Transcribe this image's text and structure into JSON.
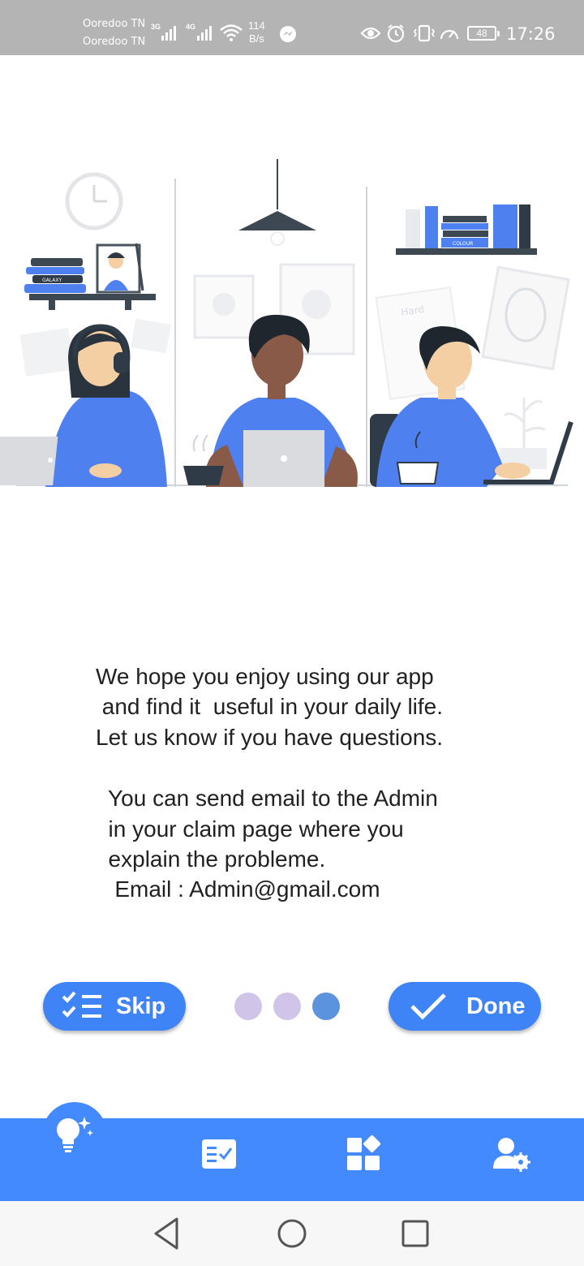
{
  "status_bar": {
    "carrier_1": "Ooredoo TN",
    "carrier_2": "Ooredoo TN",
    "net_1": "3G",
    "net_2": "4G",
    "speed_value": "114",
    "speed_unit": "B/s",
    "battery": "48",
    "time": "17:26",
    "icons": [
      "signal-icon",
      "wifi-icon",
      "messenger-icon",
      "eye-icon",
      "alarm-icon",
      "vibrate-icon",
      "speed-icon",
      "battery-icon"
    ]
  },
  "illustration": {
    "book_label_1": "GALAXY",
    "book_label_2": "COLOUR",
    "poster_text": "Hard"
  },
  "message": {
    "line_1": "We hope you enjoy using our app",
    "line_2": " and find it  useful in your daily life.",
    "line_3": "Let us know if you have questions.",
    "line_4": "  You can send email to the Admin",
    "line_5": "  in your claim page where you",
    "line_6": "  explain the probleme.",
    "line_7": "   Email : Admin@gmail.com"
  },
  "actions": {
    "skip_label": "Skip",
    "done_label": "Done"
  },
  "pager": {
    "total": 3,
    "active_index": 2,
    "inactive_color": "#d1c4e9",
    "active_color": "#5b93de"
  },
  "bottom_nav": {
    "color": "#448aff",
    "items": [
      "lightbulb-icon",
      "task-list-icon",
      "widgets-icon",
      "user-settings-icon"
    ],
    "active_index": 0
  },
  "system_nav": {
    "buttons": [
      "back-icon",
      "home-icon",
      "recents-icon"
    ]
  }
}
